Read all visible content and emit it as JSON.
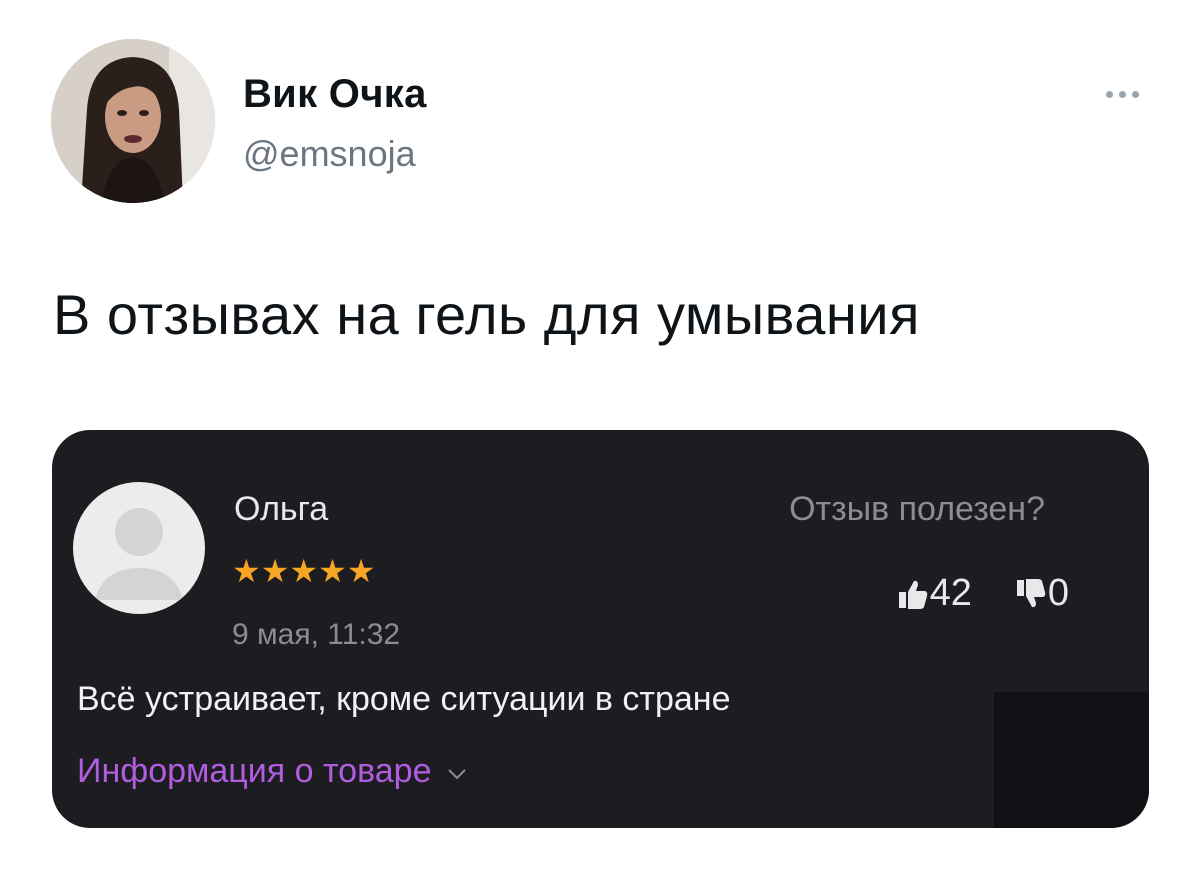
{
  "tweet": {
    "author": {
      "display_name": "Вик Очка",
      "handle": "@emsnoja"
    },
    "text": "В отзывах на гель для умывания",
    "more_icon": "more-horizontal-icon"
  },
  "review": {
    "reviewer_name": "Ольга",
    "rating": 5,
    "rating_max": 5,
    "stars": "★★★★★",
    "date": "9 мая, 11:32",
    "helpful_question": "Отзыв полезен?",
    "likes": "42",
    "dislikes": "0",
    "text": "Всё устраивает, кроме ситуации в стране",
    "product_info_link": "Информация о товаре",
    "colors": {
      "card_background": "#1d1c21",
      "star": "#f6a623",
      "link": "#b15de0"
    }
  }
}
